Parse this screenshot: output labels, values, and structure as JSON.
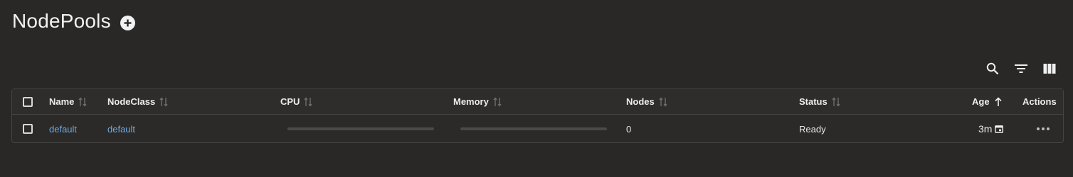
{
  "page": {
    "title": "NodePools"
  },
  "toolbar": {
    "search_icon": "search-icon",
    "filter_icon": "filter-icon",
    "columns_icon": "columns-icon"
  },
  "table": {
    "columns": [
      {
        "key": "name",
        "label": "Name",
        "sortable": true
      },
      {
        "key": "nodeclass",
        "label": "NodeClass",
        "sortable": true
      },
      {
        "key": "cpu",
        "label": "CPU",
        "sortable": true
      },
      {
        "key": "memory",
        "label": "Memory",
        "sortable": true
      },
      {
        "key": "nodes",
        "label": "Nodes",
        "sortable": true
      },
      {
        "key": "status",
        "label": "Status",
        "sortable": true
      },
      {
        "key": "age",
        "label": "Age",
        "sortable": true,
        "sort_direction": "ascending"
      },
      {
        "key": "actions",
        "label": "Actions",
        "sortable": false
      }
    ],
    "rows": [
      {
        "name": "default",
        "nodeclass": "default",
        "cpu_usage": 0,
        "memory_usage": 0,
        "nodes": "0",
        "status": "Ready",
        "age": "3m"
      }
    ]
  },
  "colors": {
    "background": "#292827",
    "link": "#6ea8de",
    "border": "#454443"
  }
}
